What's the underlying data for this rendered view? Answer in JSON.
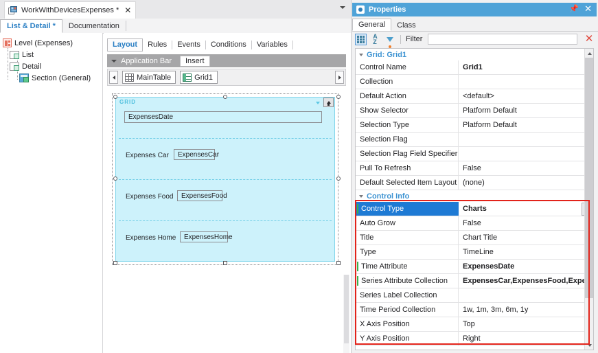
{
  "document_tab": {
    "label": "WorkWithDevicesExpenses *",
    "close": "✕",
    "icon": "document-icon"
  },
  "subtabs": [
    {
      "label": "List & Detail *",
      "active": true
    },
    {
      "label": "Documentation",
      "active": false
    }
  ],
  "tree": {
    "root": {
      "label": "Level (Expenses)",
      "icon": "level-icon"
    },
    "children": [
      {
        "label": "List",
        "icon": "node-icon"
      },
      {
        "label": "Detail",
        "icon": "node-icon"
      },
      {
        "label": "Section (General)",
        "icon": "section-icon"
      }
    ]
  },
  "editor": {
    "tabs": [
      {
        "label": "Layout",
        "active": true
      },
      {
        "label": "Rules",
        "active": false
      },
      {
        "label": "Events",
        "active": false
      },
      {
        "label": "Conditions",
        "active": false
      },
      {
        "label": "Variables",
        "active": false
      }
    ],
    "appbar": {
      "title": "Application Bar",
      "insert_label": "Insert"
    },
    "control_chips": [
      {
        "label": "MainTable",
        "icon": "table-icon"
      },
      {
        "label": "Grid1",
        "icon": "grid-icon"
      }
    ],
    "canvas": {
      "grid_label": "GRID",
      "rows": [
        {
          "label": "",
          "field": "ExpensesDate"
        },
        {
          "label": "Expenses Car",
          "field": "ExpensesCar"
        },
        {
          "label": "Expenses Food",
          "field": "ExpensesFood"
        },
        {
          "label": "Expenses Home",
          "field": "ExpensesHome"
        }
      ]
    }
  },
  "properties": {
    "title": "Properties",
    "pin": "📌",
    "close": "✕",
    "tabs": [
      {
        "label": "General",
        "active": true
      },
      {
        "label": "Class",
        "active": false
      }
    ],
    "toolbar": {
      "categorized_icon": "categorized-view-icon",
      "alphabetical_icon": "sort-alphabetical-icon",
      "filter_icon": "filter-funnel-icon",
      "filter_label": "Filter",
      "filter_value": "",
      "filter_placeholder": "",
      "clear_icon": "✕"
    },
    "groups": [
      {
        "title": "Grid: Grid1",
        "rows": [
          {
            "name": "Control Name",
            "value": "Grid1",
            "bold": true
          },
          {
            "name": "Collection",
            "value": ""
          },
          {
            "name": "Default Action",
            "value": "<default>"
          },
          {
            "name": "Show Selector",
            "value": "Platform Default"
          },
          {
            "name": "Selection Type",
            "value": "Platform Default"
          },
          {
            "name": "Selection Flag",
            "value": ""
          },
          {
            "name": "Selection Flag Field Specifier",
            "value": ""
          },
          {
            "name": "Pull To Refresh",
            "value": "False"
          },
          {
            "name": "Default Selected Item Layout",
            "value": "(none)"
          }
        ]
      },
      {
        "title": "Control Info",
        "rows": [
          {
            "name": "Control Type",
            "value": "Charts",
            "selected": true,
            "marked": true,
            "dropdown": true
          },
          {
            "name": "Auto Grow",
            "value": "False"
          },
          {
            "name": "Title",
            "value": "Chart Title"
          },
          {
            "name": "Type",
            "value": "TimeLine"
          },
          {
            "name": "Time Attribute",
            "value": "ExpensesDate",
            "bold": true,
            "marked": true
          },
          {
            "name": "Series Attribute Collection",
            "value": "ExpensesCar,ExpensesFood,Expense...",
            "bold": true,
            "marked": true
          },
          {
            "name": "Series Label Collection",
            "value": ""
          },
          {
            "name": "Time Period Collection",
            "value": "1w, 1m, 3m, 6m, 1y"
          },
          {
            "name": "X Axis Position",
            "value": "Top"
          },
          {
            "name": "Y Axis Position",
            "value": "Right"
          }
        ]
      }
    ]
  },
  "colors": {
    "accent_blue": "#4fa3d8",
    "selection_blue": "#1e7ad4",
    "highlight_red": "#e2231a",
    "grid_fill": "#cdf2fb",
    "grid_border": "#7fd4ea",
    "link_blue": "#2a7fc4"
  }
}
